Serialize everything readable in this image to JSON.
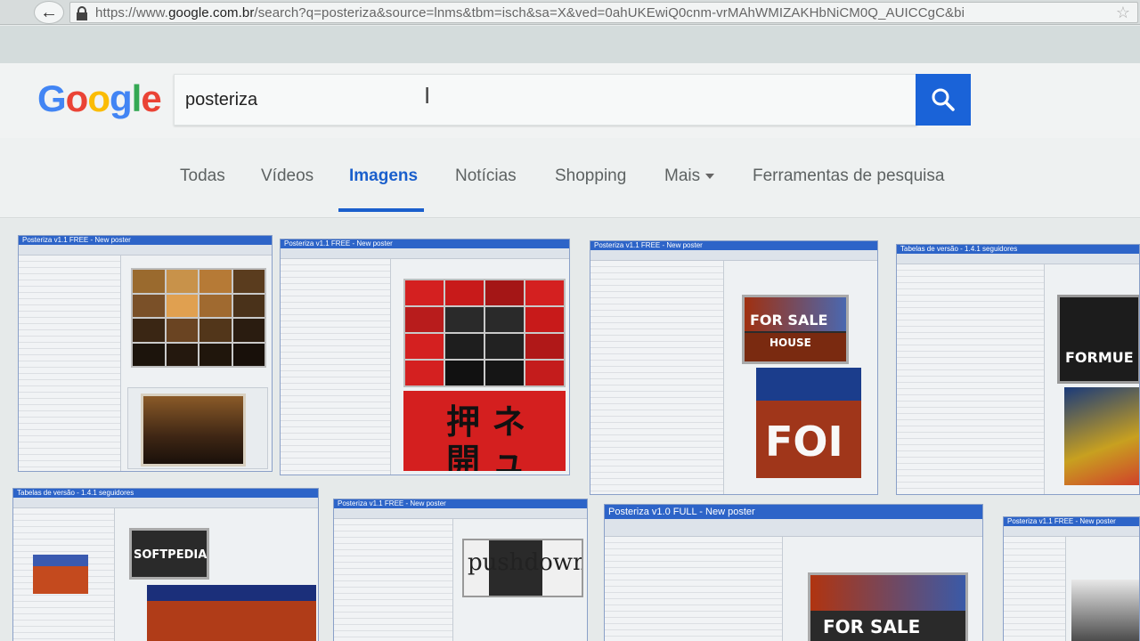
{
  "browser": {
    "url_prefix": "https://www.",
    "url_host": "google.com.br",
    "url_path": "/search?q=posteriza&source=lnms&tbm=isch&sa=X&ved=0ahUKEwiQ0cnm-vrMAhWMIZAKHbNiCM0Q_AUICCgC&bi"
  },
  "logo": {
    "text": "Google",
    "colors": [
      "#4285f4",
      "#ea4335",
      "#fbbc05",
      "#4285f4",
      "#34a853",
      "#ea4335"
    ]
  },
  "search": {
    "query": "posteriza",
    "button_icon": "search-icon",
    "accent_color": "#1a63d8"
  },
  "tabs": [
    {
      "label": "Todas"
    },
    {
      "label": "Vídeos"
    },
    {
      "label": "Imagens"
    },
    {
      "label": "Notícias"
    },
    {
      "label": "Shopping"
    },
    {
      "label": "Mais"
    },
    {
      "label": "Ferramentas de pesquisa"
    }
  ],
  "results": {
    "thumb_titles": [
      "Posteriza v1.1 FREE - New poster",
      "Posteriza v1.1 FREE - New poster",
      "Posteriza v1.1 FREE - New poster",
      "Tabelas de versão - 1.4.1 seguidores",
      "Tabelas de versão - 1.4.1 seguidores",
      "Posteriza v1.1 FREE - New poster",
      "Posteriza v1.0 FULL - New poster",
      "Posteriza v1.1 FREE - New poster"
    ],
    "poster_texts": {
      "forsale": "FOR SALE",
      "house": "HOUSE",
      "for": "FOI",
      "formue": "FORMUE",
      "softpedia": "SOFTPEDIA",
      "pushdown": "pushdown",
      "kanji1": "押 ネ",
      "kanji2": "開 ュ",
      "forsale2": "FOR SALE"
    }
  }
}
